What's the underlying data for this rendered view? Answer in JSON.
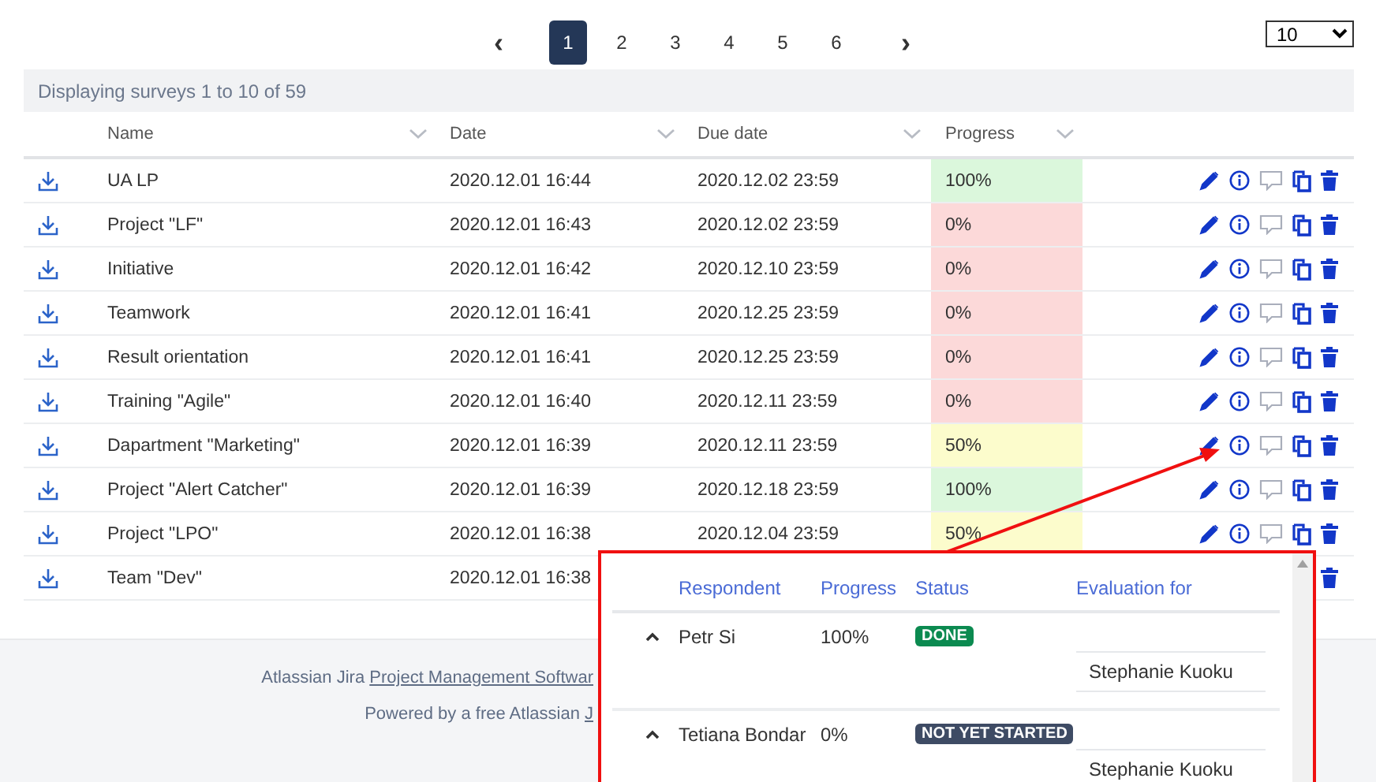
{
  "pagination": {
    "prev": "‹",
    "next": "›",
    "pages": [
      {
        "label": "1",
        "selected": true
      },
      {
        "label": "2",
        "selected": false
      },
      {
        "label": "3",
        "selected": false
      },
      {
        "label": "4",
        "selected": false
      },
      {
        "label": "5",
        "selected": false
      },
      {
        "label": "6",
        "selected": false
      }
    ]
  },
  "page_size": {
    "value": "10"
  },
  "info": "Displaying surveys 1 to 10 of 59",
  "table": {
    "columns": [
      "Name",
      "Date",
      "Due date",
      "Progress"
    ],
    "rows": [
      {
        "name": "UA LP",
        "date": "2020.12.01 16:44",
        "due_date": "2020.12.02 23:59",
        "progress": "100%",
        "color": "#dbf7dc",
        "actions": [
          {
            "kind": "edit"
          },
          {
            "kind": "info"
          },
          {
            "kind": "comment"
          },
          {
            "kind": "copy"
          },
          {
            "kind": "delete"
          }
        ]
      },
      {
        "name": "Project \"LF\"",
        "date": "2020.12.01 16:43",
        "due_date": "2020.12.02 23:59",
        "progress": "0%",
        "color": "#fcd9d9",
        "actions": [
          {
            "kind": "edit"
          },
          {
            "kind": "info"
          },
          {
            "kind": "comment"
          },
          {
            "kind": "copy"
          },
          {
            "kind": "delete"
          }
        ]
      },
      {
        "name": "Initiative",
        "date": "2020.12.01 16:42",
        "due_date": "2020.12.10 23:59",
        "progress": "0%",
        "color": "#fcd9d9",
        "actions": [
          {
            "kind": "edit"
          },
          {
            "kind": "info"
          },
          {
            "kind": "comment"
          },
          {
            "kind": "copy"
          },
          {
            "kind": "delete"
          }
        ]
      },
      {
        "name": "Teamwork",
        "date": "2020.12.01 16:41",
        "due_date": "2020.12.25 23:59",
        "progress": "0%",
        "color": "#fcd9d9",
        "actions": [
          {
            "kind": "edit"
          },
          {
            "kind": "info"
          },
          {
            "kind": "comment"
          },
          {
            "kind": "copy"
          },
          {
            "kind": "delete"
          }
        ]
      },
      {
        "name": "Result orientation",
        "date": "2020.12.01 16:41",
        "due_date": "2020.12.25 23:59",
        "progress": "0%",
        "color": "#fcd9d9",
        "actions": [
          {
            "kind": "edit"
          },
          {
            "kind": "info"
          },
          {
            "kind": "comment"
          },
          {
            "kind": "copy"
          },
          {
            "kind": "delete"
          }
        ]
      },
      {
        "name": "Training \"Agile\"",
        "date": "2020.12.01 16:40",
        "due_date": "2020.12.11 23:59",
        "progress": "0%",
        "color": "#fcd9d9",
        "actions": [
          {
            "kind": "edit"
          },
          {
            "kind": "info"
          },
          {
            "kind": "comment"
          },
          {
            "kind": "copy"
          },
          {
            "kind": "delete"
          }
        ]
      },
      {
        "name": "Dapartment \"Marketing\"",
        "date": "2020.12.01 16:39",
        "due_date": "2020.12.11 23:59",
        "progress": "50%",
        "color": "#fcfccc",
        "actions": [
          {
            "kind": "edit"
          },
          {
            "kind": "info"
          },
          {
            "kind": "comment"
          },
          {
            "kind": "copy"
          },
          {
            "kind": "delete"
          }
        ]
      },
      {
        "name": "Project \"Alert Catcher\"",
        "date": "2020.12.01 16:39",
        "due_date": "2020.12.18 23:59",
        "progress": "100%",
        "color": "#dbf7dc",
        "actions": [
          {
            "kind": "edit"
          },
          {
            "kind": "info"
          },
          {
            "kind": "comment"
          },
          {
            "kind": "copy"
          },
          {
            "kind": "delete"
          }
        ]
      },
      {
        "name": "Project \"LPO\"",
        "date": "2020.12.01 16:38",
        "due_date": "2020.12.04 23:59",
        "progress": "50%",
        "color": "#fcfccc",
        "actions": [
          {
            "kind": "edit"
          },
          {
            "kind": "info"
          },
          {
            "kind": "comment"
          },
          {
            "kind": "copy"
          },
          {
            "kind": "delete"
          }
        ]
      },
      {
        "name": "Team \"Dev\"",
        "date": "2020.12.01 16:38",
        "actions": [
          {
            "kind": "delete"
          }
        ]
      }
    ]
  },
  "footer": [
    {
      "text": "Atlassian Jira ",
      "link": "Project Management Softwar"
    },
    {
      "text": "Powered by a free Atlassian ",
      "link": "J"
    }
  ],
  "popup": {
    "columns": [
      "Respondent",
      "Progress",
      "Status",
      "Evaluation for"
    ],
    "rows": [
      {
        "expanded": true,
        "respondent": "Petr Si",
        "progress": "100%",
        "status": {
          "kind": "done",
          "label": "DONE"
        },
        "evaluation_for": "Stephanie Kuoku"
      },
      {
        "expanded": true,
        "respondent": "Tetiana Bondar",
        "progress": "0%",
        "status": {
          "kind": "not_started",
          "label": "NOT YET STARTED"
        },
        "evaluation_for": "Stephanie Kuoku"
      }
    ]
  }
}
